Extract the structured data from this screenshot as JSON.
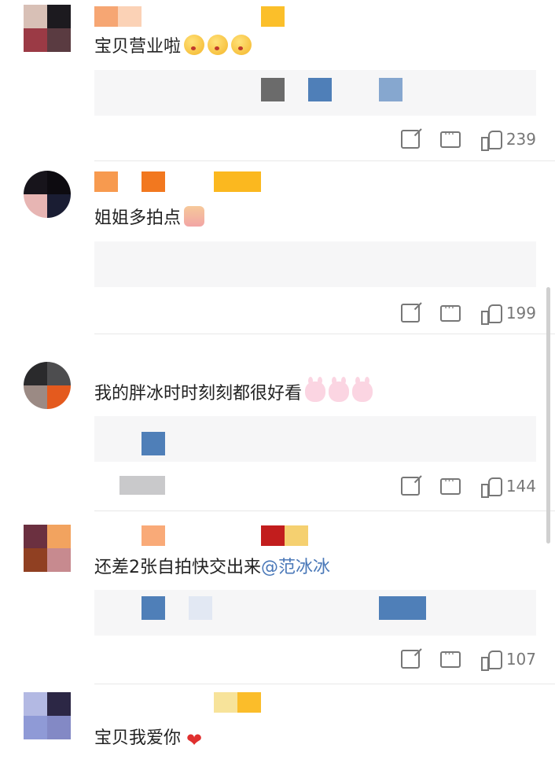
{
  "colors": {
    "mention": "#4a78b8",
    "like": "#777777",
    "heart": "#e0302f"
  },
  "comments": [
    {
      "text": "宝贝营业啦",
      "emojis": [
        "kiss-emoji",
        "kiss-emoji",
        "kiss-emoji"
      ],
      "likes": "239"
    },
    {
      "text": "姐姐多拍点",
      "emojis": [
        "girl-emoji"
      ],
      "likes": "199"
    },
    {
      "text": "我的胖冰时时刻刻都很好看",
      "emojis": [
        "bunny-emoji",
        "bunny-emoji",
        "bunny-emoji"
      ],
      "likes": "144"
    },
    {
      "text": "还差2张自拍快交出来",
      "mention": "@范冰冰",
      "likes": "107"
    },
    {
      "text": "宝贝我爱你",
      "emojis": [
        "heart-emoji"
      ]
    }
  ],
  "icons": {
    "share": "share-icon",
    "reply": "comment-icon",
    "like": "thumbs-up-icon"
  }
}
